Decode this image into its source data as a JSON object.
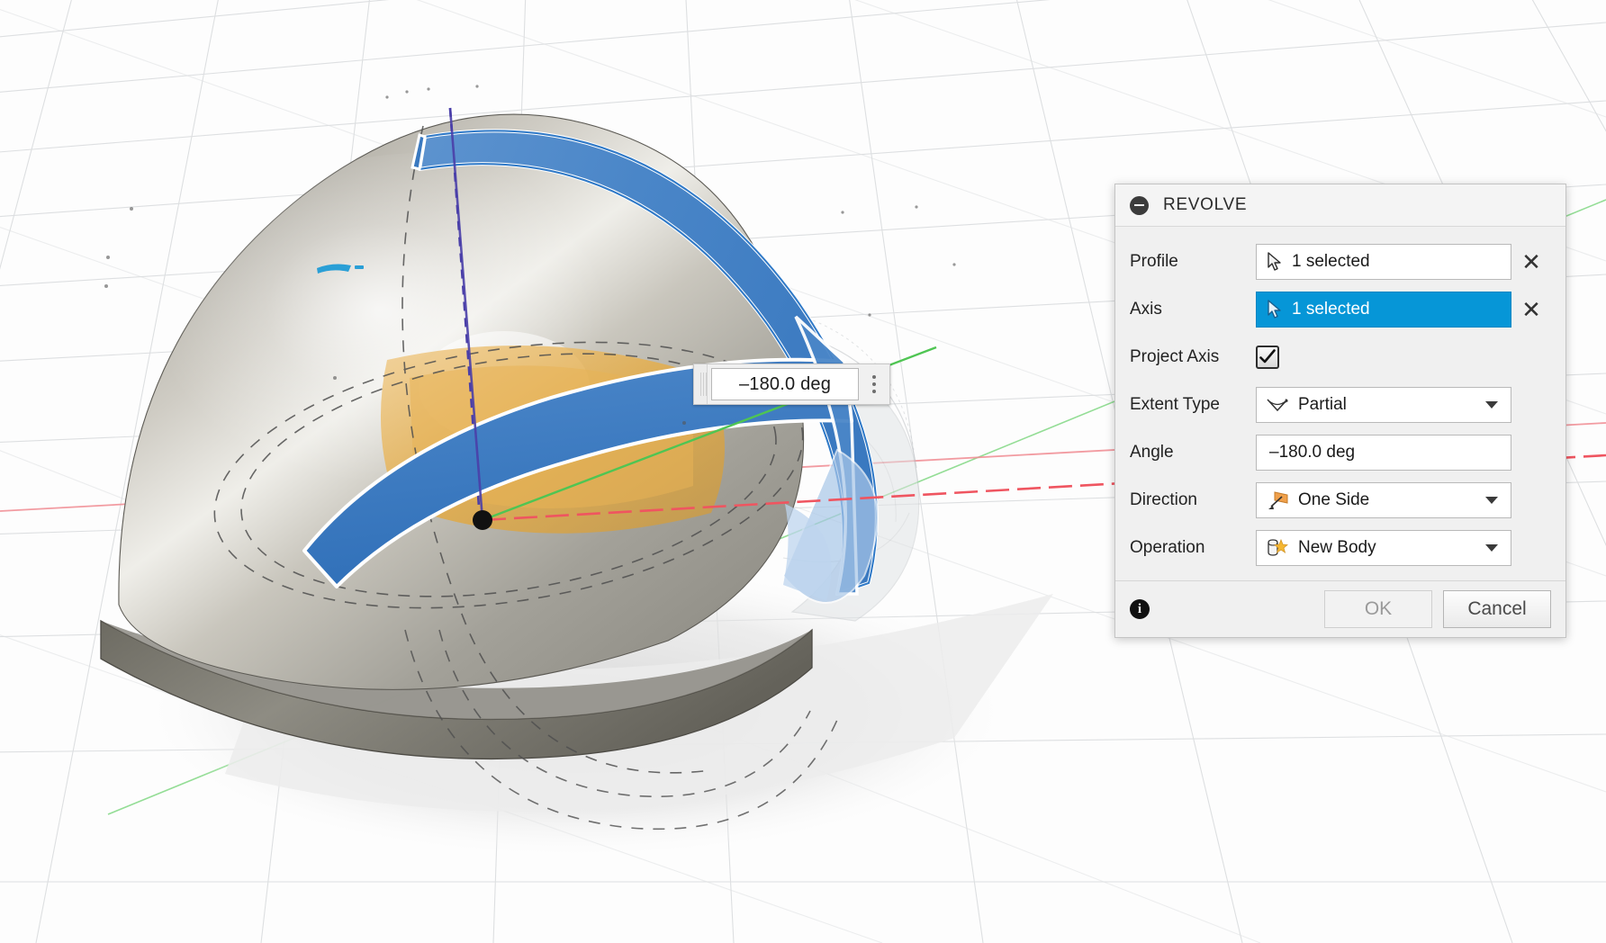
{
  "canvas": {
    "angle_widget": {
      "name": "angle-manipulator-input",
      "value": "–180.0 deg",
      "menu_icon": "kebab-menu-icon",
      "grip_icon": "drag-grip-icon"
    },
    "model": {
      "description": "Shaded grey dome (helmet-like solid) on a perspective ground grid, with a blue revolve preview band sweeping around the vertical axis",
      "colors": {
        "background": "#fdfdfd",
        "grid_line": "#d7d9db",
        "body_light": "#cdcac2",
        "body_mid": "#a6a49b",
        "body_dark": "#6e6c64",
        "preview_blue": "#4a86c8",
        "preview_blue_edge": "#2f79c7",
        "profile_amber": "#e6b24a",
        "axis_x": "#e8505b",
        "axis_y": "#53c156",
        "axis_z": "#5b47b8",
        "origin_point": "#111111",
        "ghost": "#cfd2d4",
        "shadow": "#e2e2e2"
      }
    }
  },
  "dialog": {
    "title": "REVOLVE",
    "collapse_icon": "collapse-minus-icon",
    "accent_color": "#0696D7",
    "rows": {
      "profile": {
        "label": "Profile",
        "value": "1 selected",
        "cursor_icon": "select-cursor-icon",
        "clear_icon": "clear-x-icon",
        "active": false
      },
      "axis": {
        "label": "Axis",
        "value": "1 selected",
        "cursor_icon": "select-cursor-icon",
        "clear_icon": "clear-x-icon",
        "active": true
      },
      "project_axis": {
        "label": "Project Axis",
        "checked": true,
        "check_icon": "checkmark-icon"
      },
      "extent_type": {
        "label": "Extent Type",
        "value": "Partial",
        "icon": "angle-extent-icon",
        "caret_icon": "chevron-down-icon"
      },
      "angle": {
        "label": "Angle",
        "value": "–180.0 deg"
      },
      "direction": {
        "label": "Direction",
        "value": "One Side",
        "icon": "one-side-direction-icon",
        "caret_icon": "chevron-down-icon"
      },
      "operation": {
        "label": "Operation",
        "value": "New Body",
        "icon": "new-body-icon",
        "caret_icon": "chevron-down-icon"
      }
    },
    "footer": {
      "info_icon": "info-icon",
      "info_glyph": "i",
      "ok_label": "OK",
      "ok_enabled": false,
      "cancel_label": "Cancel"
    }
  }
}
